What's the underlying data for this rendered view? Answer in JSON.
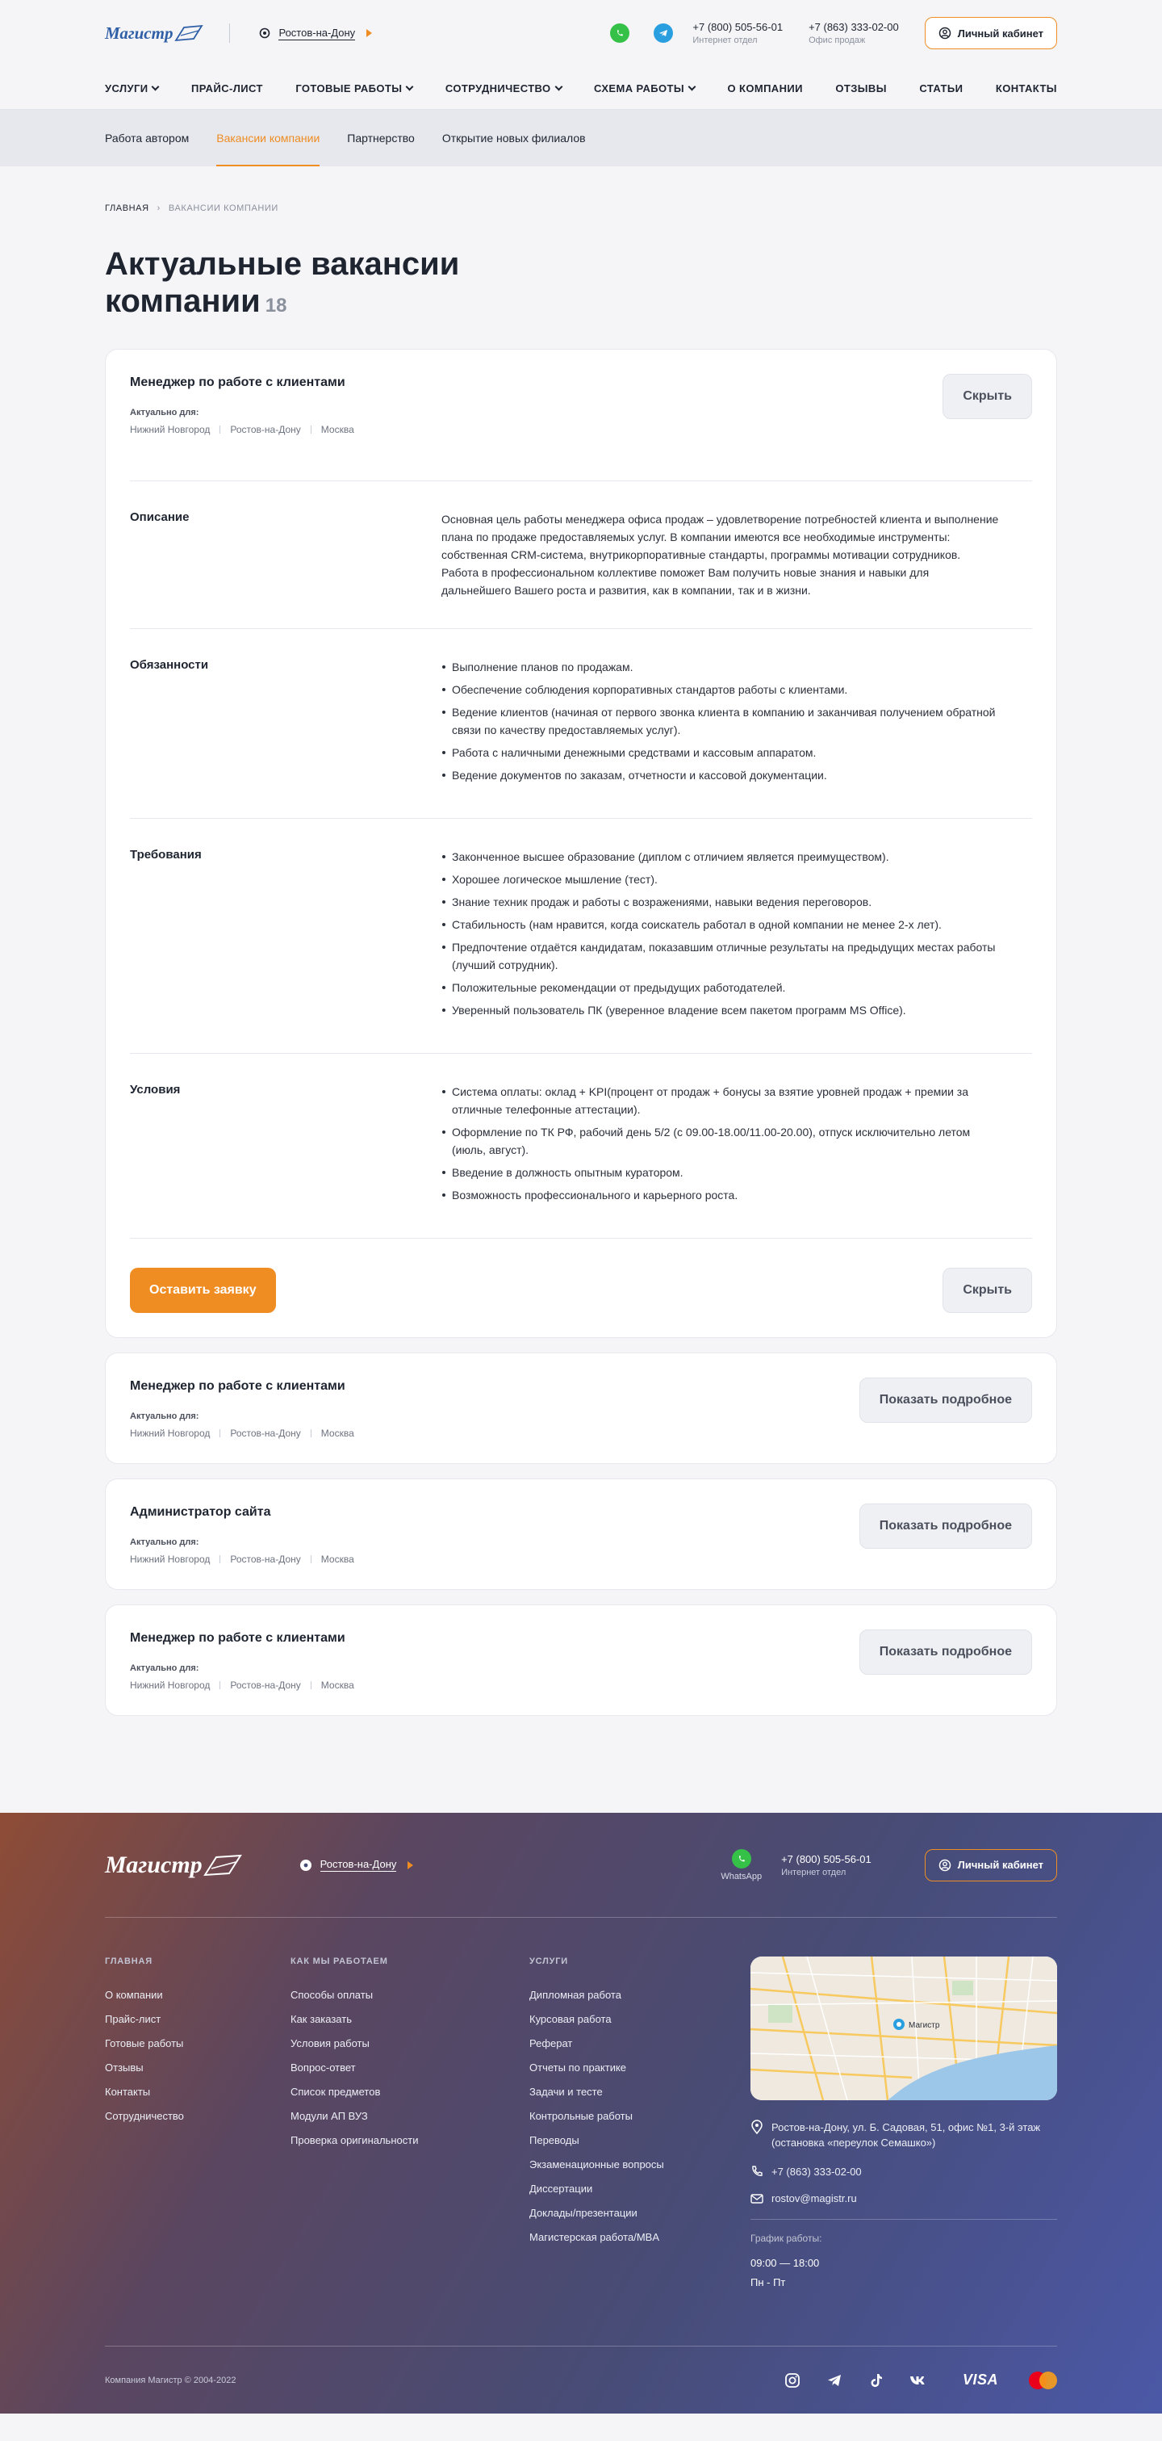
{
  "header": {
    "logo_text": "Магистр",
    "city": "Ростов-на-Дону",
    "phone1": {
      "number": "+7 (800) 505-56-01",
      "sub": "Интернет отдел"
    },
    "phone2": {
      "number": "+7 (863) 333-02-00",
      "sub": "Офис продаж"
    },
    "cabinet_label": "Личный кабинет",
    "nav": [
      {
        "label": "Услуги",
        "dropdown": true
      },
      {
        "label": "Прайс-лист",
        "dropdown": false
      },
      {
        "label": "Готовые работы",
        "dropdown": true
      },
      {
        "label": "Сотрудничество",
        "dropdown": true
      },
      {
        "label": "Схема работы",
        "dropdown": true
      },
      {
        "label": "О компании",
        "dropdown": false
      },
      {
        "label": "Отзывы",
        "dropdown": false
      },
      {
        "label": "Статьи",
        "dropdown": false
      },
      {
        "label": "Контакты",
        "dropdown": false
      }
    ]
  },
  "subnav": [
    {
      "label": "Работа автором",
      "active": false
    },
    {
      "label": "Вакансии компании",
      "active": true
    },
    {
      "label": "Партнерство",
      "active": false
    },
    {
      "label": "Открытие новых филиалов",
      "active": false
    }
  ],
  "breadcrumb": {
    "home": "Главная",
    "current": "Вакансии компании"
  },
  "page": {
    "title": "Актуальные вакансии компании",
    "count": "18"
  },
  "actual_label": "Актуально для:",
  "expanded": {
    "title": "Менеджер по работе с клиентами",
    "cities": [
      "Нижний Новгород",
      "Ростов-на-Дону",
      "Москва"
    ],
    "hide_label": "Скрыть",
    "apply_label": "Оставить заявку",
    "description_title": "Описание",
    "description": "Основная цель работы менеджера офиса продаж – удовлетворение потребностей клиента и выполнение плана по продаже предоставляемых услуг. В компании имеются все необходимые инструменты: собственная CRM-система, внутрикорпоративные стандарты, программы мотивации сотрудников. Работа в профессиональном коллективе поможет Вам получить новые знания и навыки для дальнейшего Вашего роста и развития, как в компании, так и в жизни.",
    "duties_title": "Обязанности",
    "duties": [
      "Выполнение планов по продажам.",
      "Обеспечение соблюдения корпоративных стандартов работы с клиентами.",
      "Ведение клиентов (начиная от первого звонка клиента в компанию и заканчивая получением обратной связи по качеству предоставляемых услуг).",
      "Работа с наличными денежными средствами и кассовым аппаратом.",
      "Ведение документов по заказам, отчетности и кассовой документации."
    ],
    "requirements_title": "Требования",
    "requirements": [
      "Законченное высшее образование (диплом с отличием является преимуществом).",
      "Хорошее логическое мышление (тест).",
      "Знание техник продаж и работы с возражениями, навыки ведения переговоров.",
      "Стабильность (нам нравится, когда соискатель работал в одной компании не менее 2-х лет).",
      "Предпочтение отдаётся кандидатам, показавшим отличные результаты на предыдущих местах работы (лучший сотрудник).",
      "Положительные рекомендации от предыдущих работодателей.",
      "Уверенный пользователь ПК (уверенное владение всем пакетом программ MS Office)."
    ],
    "conditions_title": "Условия",
    "conditions": [
      "Система оплаты: оклад + KPI(процент от продаж + бонусы за взятие уровней продаж + премии за отличные телефонные аттестации).",
      "Оформление по ТК РФ, рабочий день 5/2 (с 09.00-18.00/11.00-20.00), отпуск исключительно летом (июль, август).",
      "Введение в должность опытным куратором.",
      "Возможность профессионального и карьерного роста."
    ]
  },
  "show_more_label": "Показать подробное",
  "collapsed": [
    {
      "title": "Менеджер по работе с клиентами",
      "cities": [
        "Нижний Новгород",
        "Ростов-на-Дону",
        "Москва"
      ]
    },
    {
      "title": "Администратор сайта",
      "cities": [
        "Нижний Новгород",
        "Ростов-на-Дону",
        "Москва"
      ]
    },
    {
      "title": "Менеджер по работе с клиентами",
      "cities": [
        "Нижний Новгород",
        "Ростов-на-Дону",
        "Москва"
      ]
    }
  ],
  "footer": {
    "logo_text": "Магистр",
    "city": "Ростов-на-Дону",
    "whatsapp_label": "WhatsApp",
    "phone": {
      "number": "+7 (800) 505-56-01",
      "sub": "Интернет отдел"
    },
    "cabinet_label": "Личный кабинет",
    "col1": {
      "title": "Главная",
      "items": [
        "О компании",
        "Прайс-лист",
        "Готовые работы",
        "Отзывы",
        "Контакты",
        "Сотрудничество"
      ]
    },
    "col2": {
      "title": "Как мы работаем",
      "items": [
        "Способы оплаты",
        "Как заказать",
        "Условия работы",
        "Вопрос-ответ",
        "Список предметов",
        "Модули АП ВУЗ",
        "Проверка оригинальности"
      ]
    },
    "col3": {
      "title": "Услуги",
      "items": [
        "Дипломная работа",
        "Курсовая работа",
        "Реферат",
        "Отчеты по практике",
        "Задачи и тесте",
        "Контрольные работы",
        "Переводы",
        "Экзаменационные вопросы",
        "Диссертации",
        "Доклады/презентации",
        "Магистерская работа/MBA"
      ]
    },
    "map_label": "Магистр",
    "address": "Ростов-на-Дону, ул. Б. Садовая, 51, офис №1, 3-й этаж (остановка «переулок Семашко»)",
    "office_phone": "+7 (863) 333-02-00",
    "email": "rostov@magistr.ru",
    "schedule_label": "График работы:",
    "schedule_time": "09:00 — 18:00",
    "schedule_days": "Пн - Пт",
    "copyright": "Компания Магистр © 2004-2022",
    "payment_visa": "VISA"
  },
  "colors": {
    "accent": "#ef8d23",
    "brand_blue": "#2f5fa6",
    "whatsapp": "#35c148",
    "telegram": "#2a9fe0"
  }
}
